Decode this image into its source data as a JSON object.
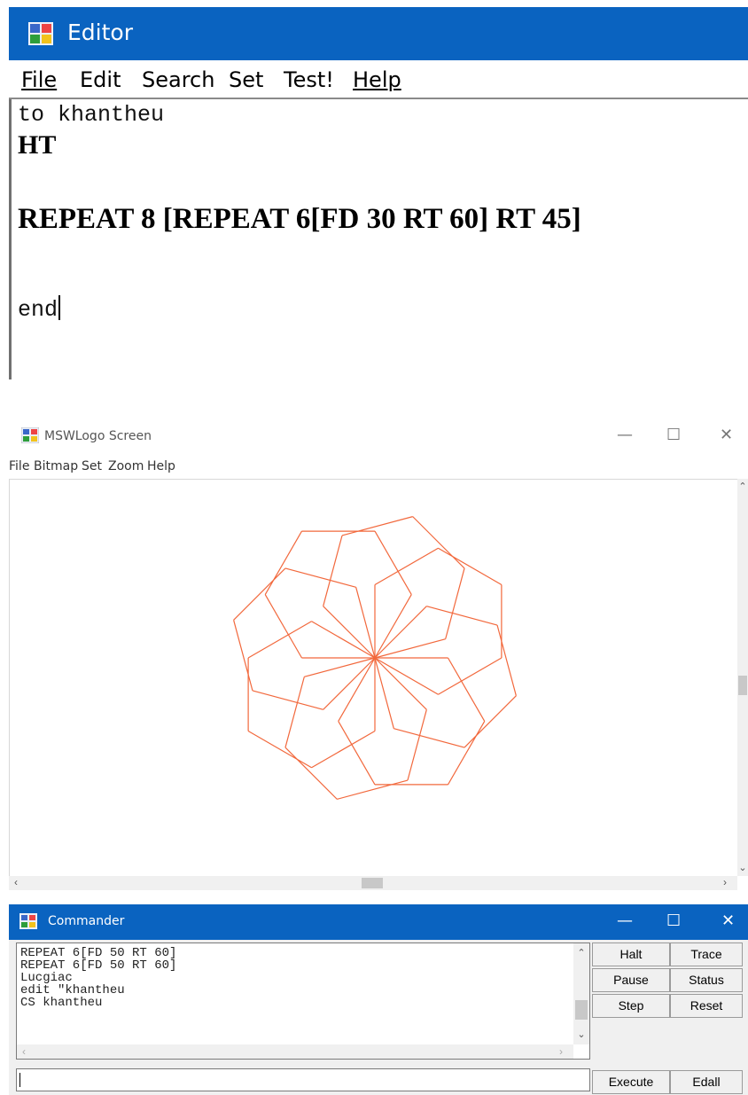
{
  "editor": {
    "title": "Editor",
    "menu": [
      "File",
      "Edit",
      "Search",
      "Set",
      "Test!",
      "Help"
    ],
    "code": {
      "line1": "to khantheu",
      "line2": "HT",
      "line3": "REPEAT 8 [REPEAT 6[FD 30 RT 60] RT 45]",
      "line4": "end"
    }
  },
  "screen": {
    "title": "MSWLogo Screen",
    "menu": [
      "File",
      "Bitmap",
      "Set",
      "Zoom",
      "Help"
    ],
    "window_controls": [
      "—",
      "☐",
      "✕"
    ],
    "drawing": {
      "procedure": "REPEAT 8 [REPEAT 6[FD 30 RT 60] RT 45]",
      "outer_repeat": 8,
      "inner_repeat": 6,
      "forward": 30,
      "inner_turn": 60,
      "outer_turn": 45,
      "pen_color": "#f2683c"
    }
  },
  "commander": {
    "title": "Commander",
    "window_controls": [
      "—",
      "☐",
      "✕"
    ],
    "history": [
      "REPEAT 6[FD 50 RT 60]",
      "REPEAT 6[FD 50 RT 60]",
      "Lucgiac",
      "edit \"khantheu",
      "CS khantheu"
    ],
    "input_value": "",
    "buttons": {
      "halt": "Halt",
      "trace": "Trace",
      "pause": "Pause",
      "status": "Status",
      "step": "Step",
      "reset": "Reset",
      "execute": "Execute",
      "edall": "Edall"
    }
  },
  "colors": {
    "titlebar_blue": "#0a63c0",
    "pen": "#f2683c"
  }
}
